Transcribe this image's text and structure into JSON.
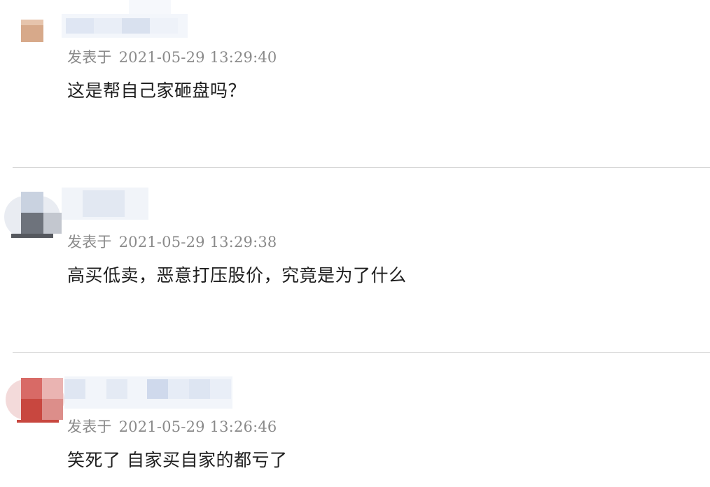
{
  "comments": [
    {
      "posted_label": "发表于",
      "timestamp": "2021-05-29 13:29:40",
      "text": "这是帮自己家砸盘吗？"
    },
    {
      "posted_label": "发表于",
      "timestamp": "2021-05-29 13:29:38",
      "text": "高买低卖，恶意打压股价，究竟是为了什么"
    },
    {
      "posted_label": "发表于",
      "timestamp": "2021-05-29 13:26:46",
      "text": "笑死了 自家买自家的都亏了"
    }
  ],
  "colors": {
    "divider": "#d6d6d6",
    "meta_text": "#8a8a8a",
    "body_text": "#1e1e1e"
  }
}
